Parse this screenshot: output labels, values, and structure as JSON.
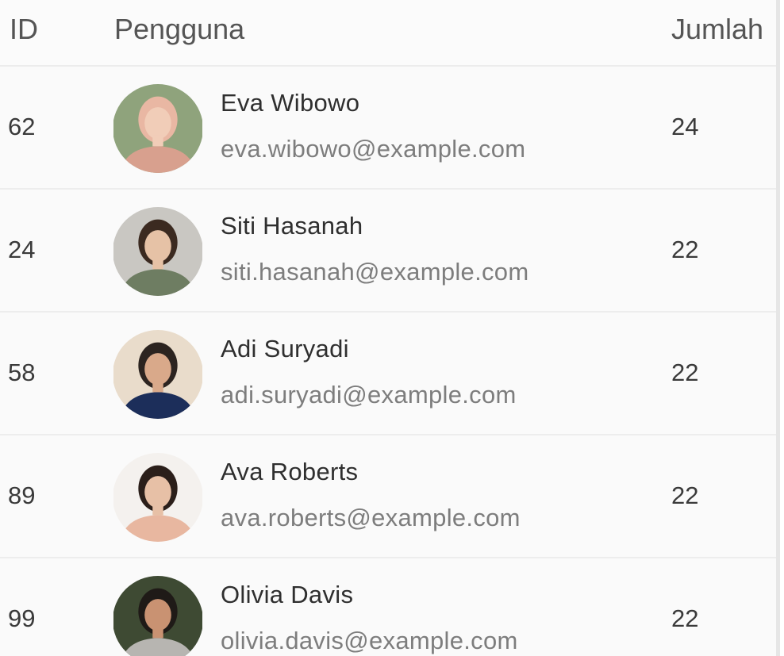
{
  "table": {
    "headers": {
      "id": "ID",
      "user": "Pengguna",
      "amount": "Jumlah"
    },
    "rows": [
      {
        "id": "62",
        "name": "Eva Wibowo",
        "email": "eva.wibowo@example.com",
        "amount": "24",
        "avatar_colors": {
          "bg": "#8fa37c",
          "hair": "#e9b7a3",
          "skin": "#f1cdb8",
          "clothes": "#d8a08e"
        }
      },
      {
        "id": "24",
        "name": "Siti Hasanah",
        "email": "siti.hasanah@example.com",
        "amount": "22",
        "avatar_colors": {
          "bg": "#c9c7c2",
          "hair": "#3b2a20",
          "skin": "#e6c2a6",
          "clothes": "#6e7d62"
        }
      },
      {
        "id": "58",
        "name": "Adi Suryadi",
        "email": "adi.suryadi@example.com",
        "amount": "22",
        "avatar_colors": {
          "bg": "#e9dccb",
          "hair": "#2c2420",
          "skin": "#d9a98a",
          "clothes": "#1c2e5a"
        }
      },
      {
        "id": "89",
        "name": "Ava Roberts",
        "email": "ava.roberts@example.com",
        "amount": "22",
        "avatar_colors": {
          "bg": "#f4f1ee",
          "hair": "#2b1f1a",
          "skin": "#e7c0a6",
          "clothes": "#e8b7a0"
        }
      },
      {
        "id": "99",
        "name": "Olivia Davis",
        "email": "olivia.davis@example.com",
        "amount": "22",
        "avatar_colors": {
          "bg": "#3e4a33",
          "hair": "#1f1a17",
          "skin": "#c99272",
          "clothes": "#b7b5b1"
        }
      }
    ]
  }
}
